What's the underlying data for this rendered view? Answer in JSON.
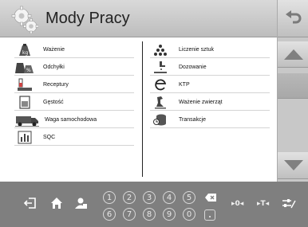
{
  "header": {
    "title": "Mody Pracy"
  },
  "left_items": [
    {
      "label": "Ważenie",
      "icon": "weighing-icon"
    },
    {
      "label": "Odchyłki",
      "icon": "deviation-icon"
    },
    {
      "label": "Receptury",
      "icon": "recipe-icon"
    },
    {
      "label": "Gęstość",
      "icon": "density-icon"
    },
    {
      "label": "Waga samochodowa",
      "icon": "truck-scale-icon"
    },
    {
      "label": "SQC",
      "icon": "sqc-icon"
    }
  ],
  "right_items": [
    {
      "label": "Liczenie sztuk",
      "icon": "counting-icon"
    },
    {
      "label": "Dozowanie",
      "icon": "dosing-icon"
    },
    {
      "label": "KTP",
      "icon": "ktp-icon"
    },
    {
      "label": "Ważenie zwierząt",
      "icon": "animal-weighing-icon"
    },
    {
      "label": "Transakcje",
      "icon": "transactions-icon"
    }
  ],
  "footer": {
    "digits_top": [
      "1",
      "2",
      "3",
      "4",
      "5"
    ],
    "digits_bottom": [
      "6",
      "7",
      "8",
      "9",
      "0"
    ],
    "dot": ".",
    "zero_key": "▸0◂",
    "tare_key": "▸T◂"
  }
}
